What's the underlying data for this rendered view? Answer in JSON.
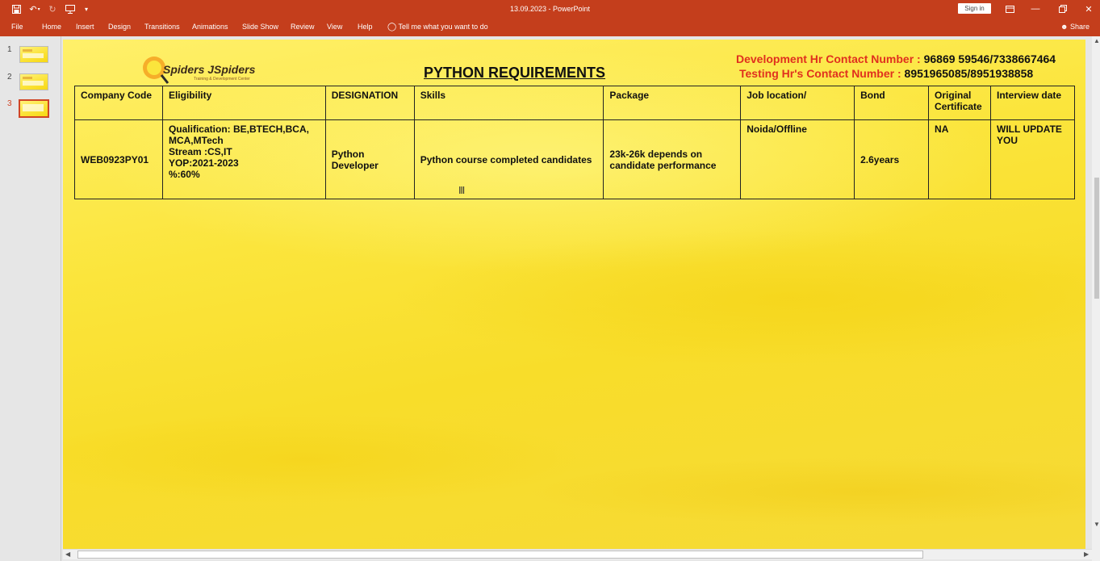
{
  "window": {
    "title": "13.09.2023  -  PowerPoint",
    "sign_in": "Sign in"
  },
  "ribbon": {
    "tabs": [
      "File",
      "Home",
      "Insert",
      "Design",
      "Transitions",
      "Animations",
      "Slide Show",
      "Review",
      "View",
      "Help"
    ],
    "tell_me": "Tell me what you want to do",
    "share": "Share"
  },
  "thumbnails": {
    "numbers": [
      "1",
      "2",
      "3"
    ],
    "selected": 3
  },
  "slide": {
    "logo_text": "Spiders JSpiders",
    "logo_sub": "Training & Development Center",
    "heading": "PYTHON REQUIREMENTS",
    "contacts": [
      {
        "label": "Development Hr Contact Number : ",
        "number": "96869 59546/7338667464"
      },
      {
        "label": "Testing Hr's Contact Number : ",
        "number": "8951965085/8951938858"
      }
    ],
    "table": {
      "headers": [
        "Company Code",
        "Eligibility",
        "DESIGNATION",
        "Skills",
        "Package",
        "Job location/",
        "Bond",
        "Original Certificate",
        "Interview date"
      ],
      "row": {
        "company_code": "WEB0923PY01",
        "eligibility": [
          "Qualification: BE,BTECH,BCA,",
          "MCA,MTech",
          "Stream :CS,IT",
          "YOP:2021-2023",
          "%:60%"
        ],
        "designation": [
          "Python",
          "Developer"
        ],
        "skills": "Python course completed candidates",
        "package": [
          "23k-26k depends on",
          "candidate performance"
        ],
        "job_location": "Noida/Offline",
        "bond": "2.6years",
        "original_certificate": "NA",
        "interview_date": [
          "WILL UPDATE",
          "YOU"
        ]
      }
    }
  },
  "colors": {
    "ribbon": "#c43e1c",
    "slide_yellow": "#fbe53c",
    "contact_red": "#e0301e"
  }
}
